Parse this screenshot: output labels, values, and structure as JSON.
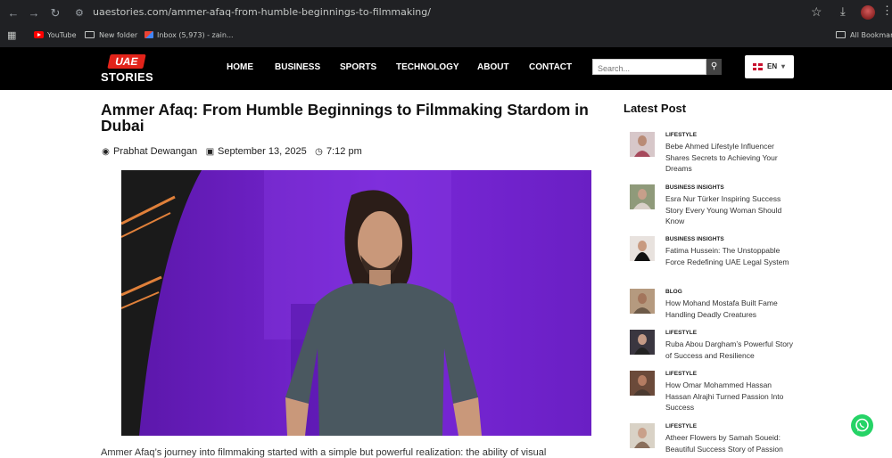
{
  "browser": {
    "url": "uaestories.com/ammer-afaq-from-humble-beginnings-to-filmmaking/",
    "bookmarks": [
      {
        "label": "YouTube"
      },
      {
        "label": "New folder"
      },
      {
        "label": "Inbox (5,973) - zain..."
      }
    ],
    "all_bookmarks": "All Bookmarks"
  },
  "site": {
    "logo_badge": "UAE",
    "logo_text": "STORIES",
    "nav": [
      "HOME",
      "BUSINESS",
      "SPORTS",
      "TECHNOLOGY",
      "ABOUT",
      "CONTACT"
    ],
    "search_placeholder": "Search...",
    "language": "EN"
  },
  "article": {
    "title": "Ammer Afaq: From Humble Beginnings to Filmmaking Stardom in Dubai",
    "author": "Prabhat Dewangan",
    "date": "September 13, 2025",
    "time": "7:12 pm",
    "body_start": "Ammer Afaq’s journey into filmmaking started with a simple but powerful realization: the ability of visual"
  },
  "sidebar": {
    "heading": "Latest Post",
    "posts": [
      {
        "category": "LIFESTYLE",
        "title": "Bebe Ahmed Lifestyle Influencer Shares Secrets to Achieving Your Dreams"
      },
      {
        "category": "BUSINESS INSIGHTS",
        "title": "Esra Nur Türker Inspiring Success Story Every Young Woman Should Know"
      },
      {
        "category": "BUSINESS INSIGHTS",
        "title": "Fatima Hussein: The Unstoppable Force Redefining UAE Legal System"
      },
      {
        "category": "BLOG",
        "title": "How Mohand Mostafa Built Fame Handling Deadly Creatures"
      },
      {
        "category": "LIFESTYLE",
        "title": "Ruba Abou Dargham’s Powerful Story of Success and Resilience"
      },
      {
        "category": "LIFESTYLE",
        "title": "How Omar Mohammed Hassan Hassan Alrajhi Turned Passion Into Success"
      },
      {
        "category": "LIFESTYLE",
        "title": "Atheer Flowers by Samah Soueid: Beautiful Success Story of Passion"
      }
    ]
  },
  "colors": {
    "header_bg": "#000000",
    "logo_red": "#e2231a",
    "hero_purple": "#6a1fc4",
    "whatsapp": "#25d366"
  }
}
